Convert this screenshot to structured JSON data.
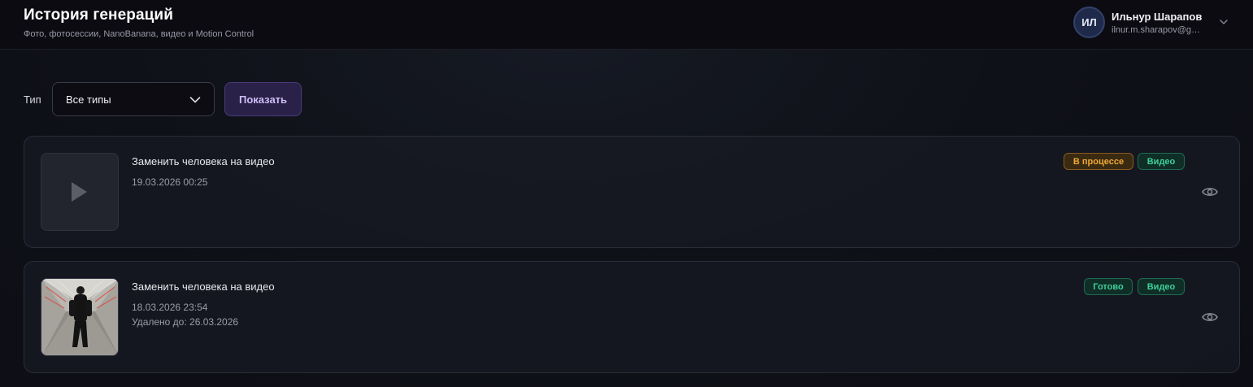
{
  "header": {
    "title": "История генераций",
    "subtitle": "Фото, фотосессии, NanoBanana, видео и Motion Control"
  },
  "user": {
    "initials": "ИЛ",
    "name": "Ильнур Шарапов",
    "email": "ilnur.m.sharapov@g…"
  },
  "filters": {
    "type_label": "Тип",
    "type_value": "Все типы",
    "show_button": "Показать"
  },
  "items": [
    {
      "title": "Заменить человека на видео",
      "date": "19.03.2026 00:25",
      "status": "В процессе",
      "kind": "Видео",
      "thumbnail": "play-icon"
    },
    {
      "title": "Заменить человека на видео",
      "date": "18.03.2026 23:54",
      "deleted_until": "Удалено до: 26.03.2026",
      "status": "Готово",
      "kind": "Видео",
      "thumbnail": "video-preview-person-in-tunnel"
    }
  ],
  "colors": {
    "accent_button": "#2a2148",
    "status_in_progress": "#f0a935",
    "status_done": "#3fd09a"
  }
}
